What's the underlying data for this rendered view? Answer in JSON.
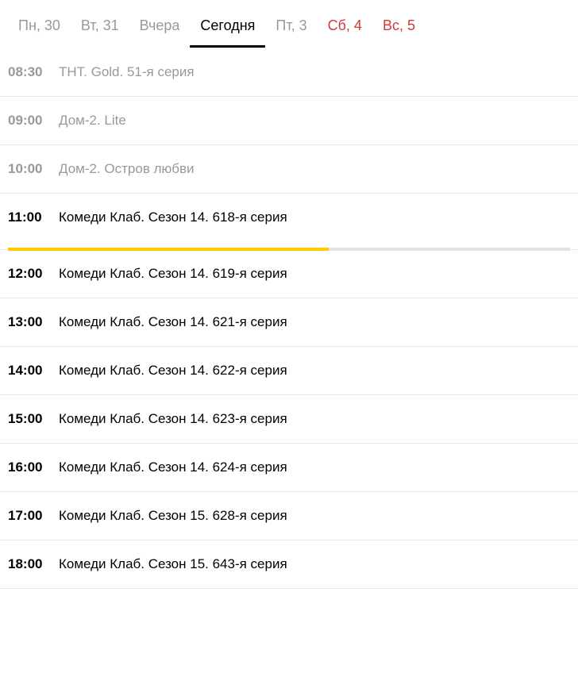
{
  "tabs": [
    {
      "label": "Пн, 30",
      "weekend": false,
      "active": false
    },
    {
      "label": "Вт, 31",
      "weekend": false,
      "active": false
    },
    {
      "label": "Вчера",
      "weekend": false,
      "active": false
    },
    {
      "label": "Сегодня",
      "weekend": false,
      "active": true
    },
    {
      "label": "Пт, 3",
      "weekend": false,
      "active": false
    },
    {
      "label": "Сб, 4",
      "weekend": true,
      "active": false
    },
    {
      "label": "Вс, 5",
      "weekend": true,
      "active": false
    }
  ],
  "schedule": [
    {
      "time": "08:30",
      "title": "ТНТ. Gold. 51-я серия",
      "state": "past"
    },
    {
      "time": "09:00",
      "title": "Дом-2. Lite",
      "state": "past"
    },
    {
      "time": "10:00",
      "title": "Дом-2. Остров любви",
      "state": "past"
    },
    {
      "time": "11:00",
      "title": "Комеди Клаб. Сезон 14. 618-я серия",
      "state": "current",
      "progress": 57
    },
    {
      "time": "12:00",
      "title": "Комеди Клаб. Сезон 14. 619-я серия",
      "state": "future"
    },
    {
      "time": "13:00",
      "title": "Комеди Клаб. Сезон 14. 621-я серия",
      "state": "future"
    },
    {
      "time": "14:00",
      "title": "Комеди Клаб. Сезон 14. 622-я серия",
      "state": "future"
    },
    {
      "time": "15:00",
      "title": "Комеди Клаб. Сезон 14. 623-я серия",
      "state": "future"
    },
    {
      "time": "16:00",
      "title": "Комеди Клаб. Сезон 14. 624-я серия",
      "state": "future"
    },
    {
      "time": "17:00",
      "title": "Комеди Клаб. Сезон 15. 628-я серия",
      "state": "future"
    },
    {
      "time": "18:00",
      "title": "Комеди Клаб. Сезон 15. 643-я серия",
      "state": "future"
    }
  ]
}
